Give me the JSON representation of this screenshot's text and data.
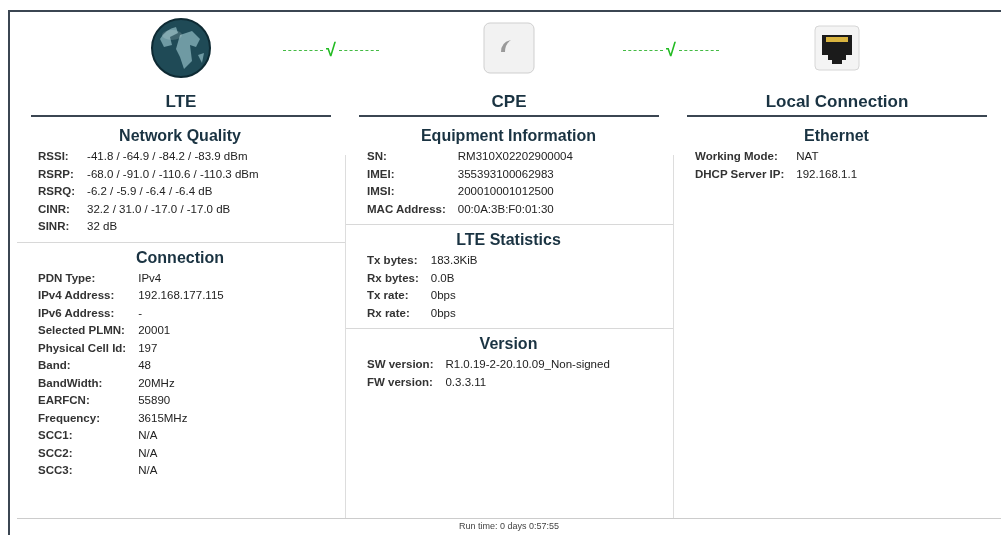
{
  "links": [
    {
      "mark": "√",
      "ok": true
    },
    {
      "mark": "√",
      "ok": true
    }
  ],
  "columns": [
    {
      "kind": "globe",
      "title": "LTE",
      "sections": [
        {
          "title": "Network Quality",
          "rows": [
            {
              "label": "RSSI:",
              "value": "-41.8 / -64.9 / -84.2 / -83.9 dBm"
            },
            {
              "label": "RSRP:",
              "value": "-68.0 / -91.0 / -110.6 / -110.3 dBm"
            },
            {
              "label": "RSRQ:",
              "value": "-6.2 / -5.9 / -6.4 / -6.4 dB"
            },
            {
              "label": "CINR:",
              "value": "32.2 / 31.0 / -17.0 / -17.0 dB"
            },
            {
              "label": "SINR:",
              "value": "32 dB"
            }
          ]
        },
        {
          "title": "Connection",
          "rows": [
            {
              "label": "PDN Type:",
              "value": "IPv4"
            },
            {
              "label": "IPv4 Address:",
              "value": "192.168.177.115"
            },
            {
              "label": "IPv6 Address:",
              "value": "-"
            },
            {
              "label": "Selected PLMN:",
              "value": "20001"
            },
            {
              "label": "Physical Cell Id:",
              "value": "197"
            },
            {
              "label": "Band:",
              "value": "48"
            },
            {
              "label": "BandWidth:",
              "value": "20MHz"
            },
            {
              "label": "EARFCN:",
              "value": "55890"
            },
            {
              "label": "Frequency:",
              "value": "3615MHz"
            },
            {
              "label": "SCC1:",
              "value": "N/A"
            },
            {
              "label": "SCC2:",
              "value": "N/A"
            },
            {
              "label": "SCC3:",
              "value": "N/A"
            }
          ]
        }
      ]
    },
    {
      "kind": "device",
      "title": "CPE",
      "sections": [
        {
          "title": "Equipment Information",
          "rows": [
            {
              "label": "SN:",
              "value": "RM310X02202900004"
            },
            {
              "label": "IMEI:",
              "value": "355393100062983"
            },
            {
              "label": "IMSI:",
              "value": "200010001012500"
            },
            {
              "label": "MAC Address:",
              "value": "00:0A:3B:F0:01:30"
            }
          ]
        },
        {
          "title": "LTE Statistics",
          "rows": [
            {
              "label": "Tx bytes:",
              "value": "183.3KiB"
            },
            {
              "label": "Rx bytes:",
              "value": "0.0B"
            },
            {
              "label": "Tx rate:",
              "value": "0bps"
            },
            {
              "label": "Rx rate:",
              "value": "0bps"
            }
          ]
        },
        {
          "title": "Version",
          "rows": [
            {
              "label": "SW version:",
              "value": "R1.0.19-2-20.10.09_Non-signed"
            },
            {
              "label": "FW version:",
              "value": "0.3.3.11"
            }
          ]
        }
      ]
    },
    {
      "kind": "ethernet",
      "title": "Local Connection",
      "sections": [
        {
          "title": "Ethernet",
          "rows": [
            {
              "label": "Working Mode:",
              "value": "NAT"
            },
            {
              "label": "DHCP Server IP:",
              "value": "192.168.1.1"
            }
          ]
        }
      ]
    }
  ],
  "footer": "Run time: 0 days 0:57:55"
}
